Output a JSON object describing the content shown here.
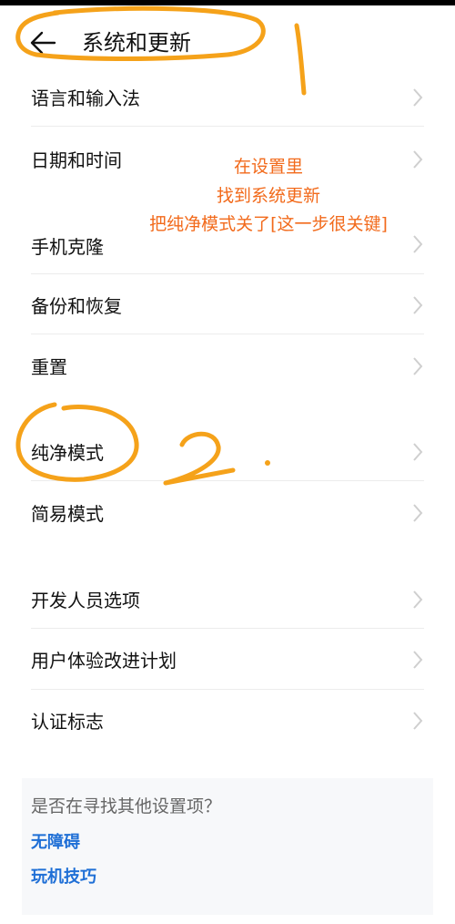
{
  "header": {
    "title": "系统和更新"
  },
  "settings": {
    "items": [
      {
        "label": "语言和输入法"
      },
      {
        "label": "日期和时间"
      },
      {
        "label": "手机克隆"
      },
      {
        "label": "备份和恢复"
      },
      {
        "label": "重置"
      },
      {
        "label": "纯净模式"
      },
      {
        "label": "简易模式"
      },
      {
        "label": "开发人员选项"
      },
      {
        "label": "用户体验改进计划"
      },
      {
        "label": "认证标志"
      }
    ]
  },
  "suggestions": {
    "title": "是否在寻找其他设置项？",
    "links": [
      {
        "label": "无障碍"
      },
      {
        "label": "玩机技巧"
      }
    ]
  },
  "annotation": {
    "lines": [
      "在设置里",
      "找到系统更新",
      "把纯净模式关了[这一步很关键]"
    ],
    "marks": [
      "1",
      "2."
    ]
  },
  "colors": {
    "annotation": "#f26a1b",
    "link": "#1f6fd6"
  }
}
